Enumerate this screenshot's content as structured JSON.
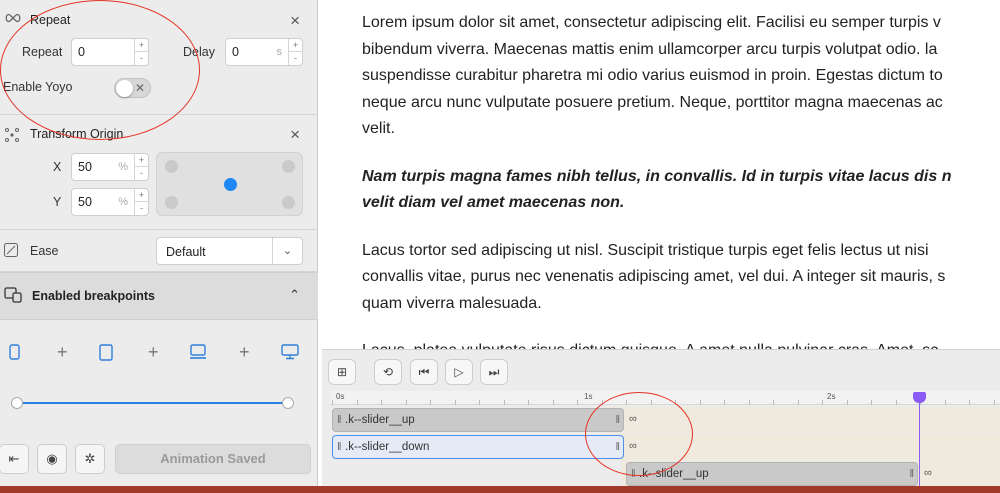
{
  "left_panel": {
    "repeat_section": {
      "title": "Repeat",
      "repeat_label": "Repeat",
      "repeat_value": "0",
      "delay_label": "Delay",
      "delay_value": "0",
      "delay_unit": "s",
      "yoyo_label": "Enable Yoyo",
      "yoyo_enabled": false
    },
    "transform_origin": {
      "title": "Transform Origin",
      "x_label": "X",
      "x_value": "50",
      "y_label": "Y",
      "y_value": "50",
      "unit": "%"
    },
    "ease": {
      "label": "Ease",
      "value": "Default"
    },
    "breakpoints": {
      "title": "Enabled breakpoints"
    },
    "footer": {
      "saved_label": "Animation Saved"
    }
  },
  "document": {
    "para1": [
      "Lorem ipsum dolor sit amet, consectetur adipiscing elit. Facilisi eu semper turpis v",
      "bibendum viverra. Maecenas mattis enim ullamcorper arcu turpis volutpat odio. la",
      "suspendisse curabitur pharetra mi odio varius euismod in proin. Egestas dictum to",
      "neque arcu nunc vulputate posuere pretium. Neque, porttitor magna maecenas ac",
      "velit."
    ],
    "para2": [
      "Nam turpis magna fames nibh tellus, in convallis. Id in turpis vitae lacus dis n",
      "velit diam vel amet maecenas non."
    ],
    "para3": [
      "Lacus tortor sed adipiscing ut nisl. Suscipit tristique turpis eget felis lectus ut nisi",
      "convallis vitae, purus nec venenatis adipiscing amet, vel dui. A integer sit mauris, s",
      "quam viverra malesuada."
    ],
    "para4_partial": "Lacus, platea vulputate risus dictum quisque. A amet nulla pulvinar cras. Amet, sc"
  },
  "timeline": {
    "ruler_labels": [
      "0s",
      "1s",
      "2s"
    ],
    "tracks": [
      {
        "name": ".k--slider__up"
      },
      {
        "name": ".k--slider__down"
      },
      {
        "name": ".k--slider__up"
      }
    ]
  },
  "colors": {
    "accent": "#1e88f5",
    "playhead": "#8b5cf6",
    "annotation": "#e53424"
  }
}
